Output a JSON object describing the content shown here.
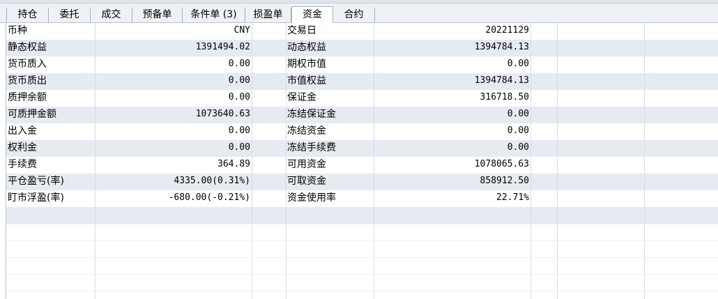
{
  "tabs": [
    "持仓",
    "委托",
    "成交",
    "预备单",
    "条件单 (3)",
    "损盈单",
    "资金",
    "合约"
  ],
  "active_tab": "资金",
  "rows": [
    {
      "label1": "币种",
      "value1": "CNY",
      "label2": "交易日",
      "value2": "20221129"
    },
    {
      "label1": "静态权益",
      "value1": "1391494.02",
      "label2": "动态权益",
      "value2": "1394784.13"
    },
    {
      "label1": "货币质入",
      "value1": "0.00",
      "label2": "期权市值",
      "value2": "0.00"
    },
    {
      "label1": "货币质出",
      "value1": "0.00",
      "label2": "市值权益",
      "value2": "1394784.13"
    },
    {
      "label1": "质押余额",
      "value1": "0.00",
      "label2": "保证金",
      "value2": "316718.50"
    },
    {
      "label1": "可质押金额",
      "value1": "1073640.63",
      "label2": "冻结保证金",
      "value2": "0.00"
    },
    {
      "label1": "出入金",
      "value1": "0.00",
      "label2": "冻结资金",
      "value2": "0.00"
    },
    {
      "label1": "权利金",
      "value1": "0.00",
      "label2": "冻结手续费",
      "value2": "0.00"
    },
    {
      "label1": "手续费",
      "value1": "364.89",
      "label2": "可用资金",
      "value2": "1078065.63"
    },
    {
      "label1": "平仓盈亏(率)",
      "value1": "4335.00(0.31%)",
      "label2": "可取资金",
      "value2": "858912.50"
    },
    {
      "label1": "盯市浮盈(率)",
      "value1": "-680.00(-0.21%)",
      "label2": "资金使用率",
      "value2": "22.71%"
    }
  ],
  "colors": {
    "row_alt": "#e6eaf1",
    "tabbar_bg": "#eef1f5",
    "grid_line": "#d7dce4"
  }
}
